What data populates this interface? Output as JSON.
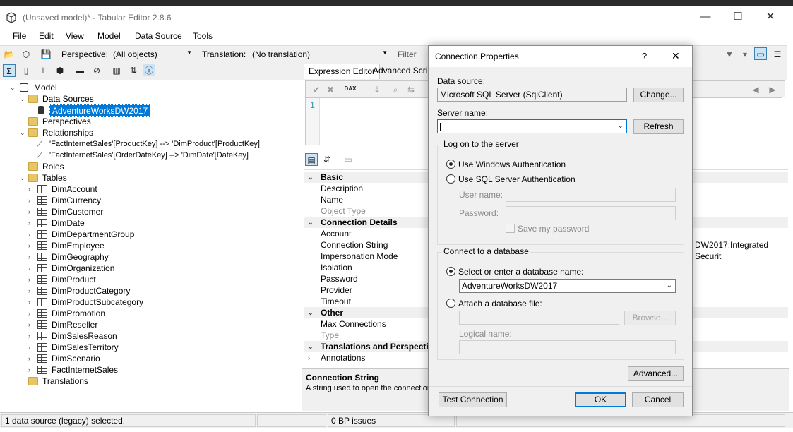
{
  "window": {
    "title": "(Unsaved model)* - Tabular Editor 2.8.6"
  },
  "menu": [
    "File",
    "Edit",
    "View",
    "Model",
    "Data Source",
    "Tools"
  ],
  "toolbar": {
    "perspective_label": "Perspective:",
    "perspective_value": "(All objects)",
    "translation_label": "Translation:",
    "translation_value": "(No translation)",
    "filter_label": "Filter"
  },
  "tree": {
    "model": "Model",
    "data_sources": "Data Sources",
    "data_source_item": "AdventureWorksDW2017",
    "perspectives": "Perspectives",
    "relationships": "Relationships",
    "relationship_items": [
      "'FactInternetSales'[ProductKey] --> 'DimProduct'[ProductKey]",
      "'FactInternetSales'[OrderDateKey] --> 'DimDate'[DateKey]"
    ],
    "roles": "Roles",
    "tables_label": "Tables",
    "tables": [
      "DimAccount",
      "DimCurrency",
      "DimCustomer",
      "DimDate",
      "DimDepartmentGroup",
      "DimEmployee",
      "DimGeography",
      "DimOrganization",
      "DimProduct",
      "DimProductCategory",
      "DimProductSubcategory",
      "DimPromotion",
      "DimReseller",
      "DimSalesReason",
      "DimSalesTerritory",
      "DimScenario",
      "FactInternetSales"
    ],
    "translations": "Translations"
  },
  "tabs": [
    "Expression Editor",
    "Advanced Script"
  ],
  "editor": {
    "line1": "1"
  },
  "properties": {
    "cat_basic": "Basic",
    "basic": [
      "Description",
      "Name",
      "Object Type"
    ],
    "cat_connection": "Connection Details",
    "connection": [
      "Account",
      "Connection String",
      "Impersonation Mode",
      "Isolation",
      "Password",
      "Provider",
      "Timeout"
    ],
    "cat_other": "Other",
    "other": [
      "Max Connections",
      "Type"
    ],
    "cat_translations": "Translations and Perspectives",
    "annotations": "Annotations",
    "conn_value_fragment": "DW2017;Integrated Securit"
  },
  "description": {
    "title": "Connection String",
    "text": "A string used to open the connection."
  },
  "status": {
    "selection": "1 data source (legacy) selected.",
    "bp": "0 BP issues"
  },
  "dialog": {
    "title": "Connection Properties",
    "help": "?",
    "close": "✕",
    "data_source_label": "Data source:",
    "data_source_value": "Microsoft SQL Server (SqlClient)",
    "change_button": "Change...",
    "server_name_label": "Server name:",
    "server_name_value": "",
    "refresh_button": "Refresh",
    "logon_group": "Log on to the server",
    "windows_auth": "Use Windows Authentication",
    "sql_auth": "Use SQL Server Authentication",
    "user_name_label": "User name:",
    "password_label": "Password:",
    "save_password": "Save my password",
    "connect_group": "Connect to a database",
    "select_db": "Select or enter a database name:",
    "db_name_value": "AdventureWorksDW2017",
    "attach_file": "Attach a database file:",
    "browse_button": "Browse...",
    "logical_name_label": "Logical name:",
    "advanced_button": "Advanced...",
    "test_button": "Test Connection",
    "ok_button": "OK",
    "cancel_button": "Cancel"
  }
}
